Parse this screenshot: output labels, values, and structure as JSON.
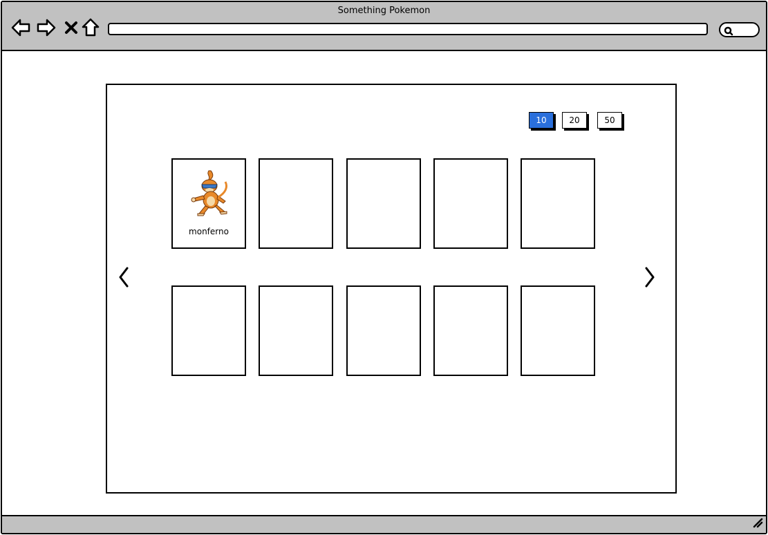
{
  "window": {
    "title": "Something Pokemon"
  },
  "browser": {
    "address": "",
    "search": ""
  },
  "page_size": {
    "options": [
      "10",
      "20",
      "50"
    ],
    "selected": "10"
  },
  "cards": [
    {
      "name": "monferno"
    },
    {
      "name": ""
    },
    {
      "name": ""
    },
    {
      "name": ""
    },
    {
      "name": ""
    },
    {
      "name": ""
    },
    {
      "name": ""
    },
    {
      "name": ""
    },
    {
      "name": ""
    },
    {
      "name": ""
    }
  ],
  "icons": {
    "back": "back-arrow-icon",
    "forward": "forward-arrow-icon",
    "stop": "close-icon",
    "home": "home-icon",
    "search": "search-icon",
    "prev": "chevron-left-icon",
    "next": "chevron-right-icon",
    "grip": "resize-grip-icon"
  },
  "colors": {
    "chrome": "#c1c1c1",
    "selected": "#2a6fdb"
  }
}
